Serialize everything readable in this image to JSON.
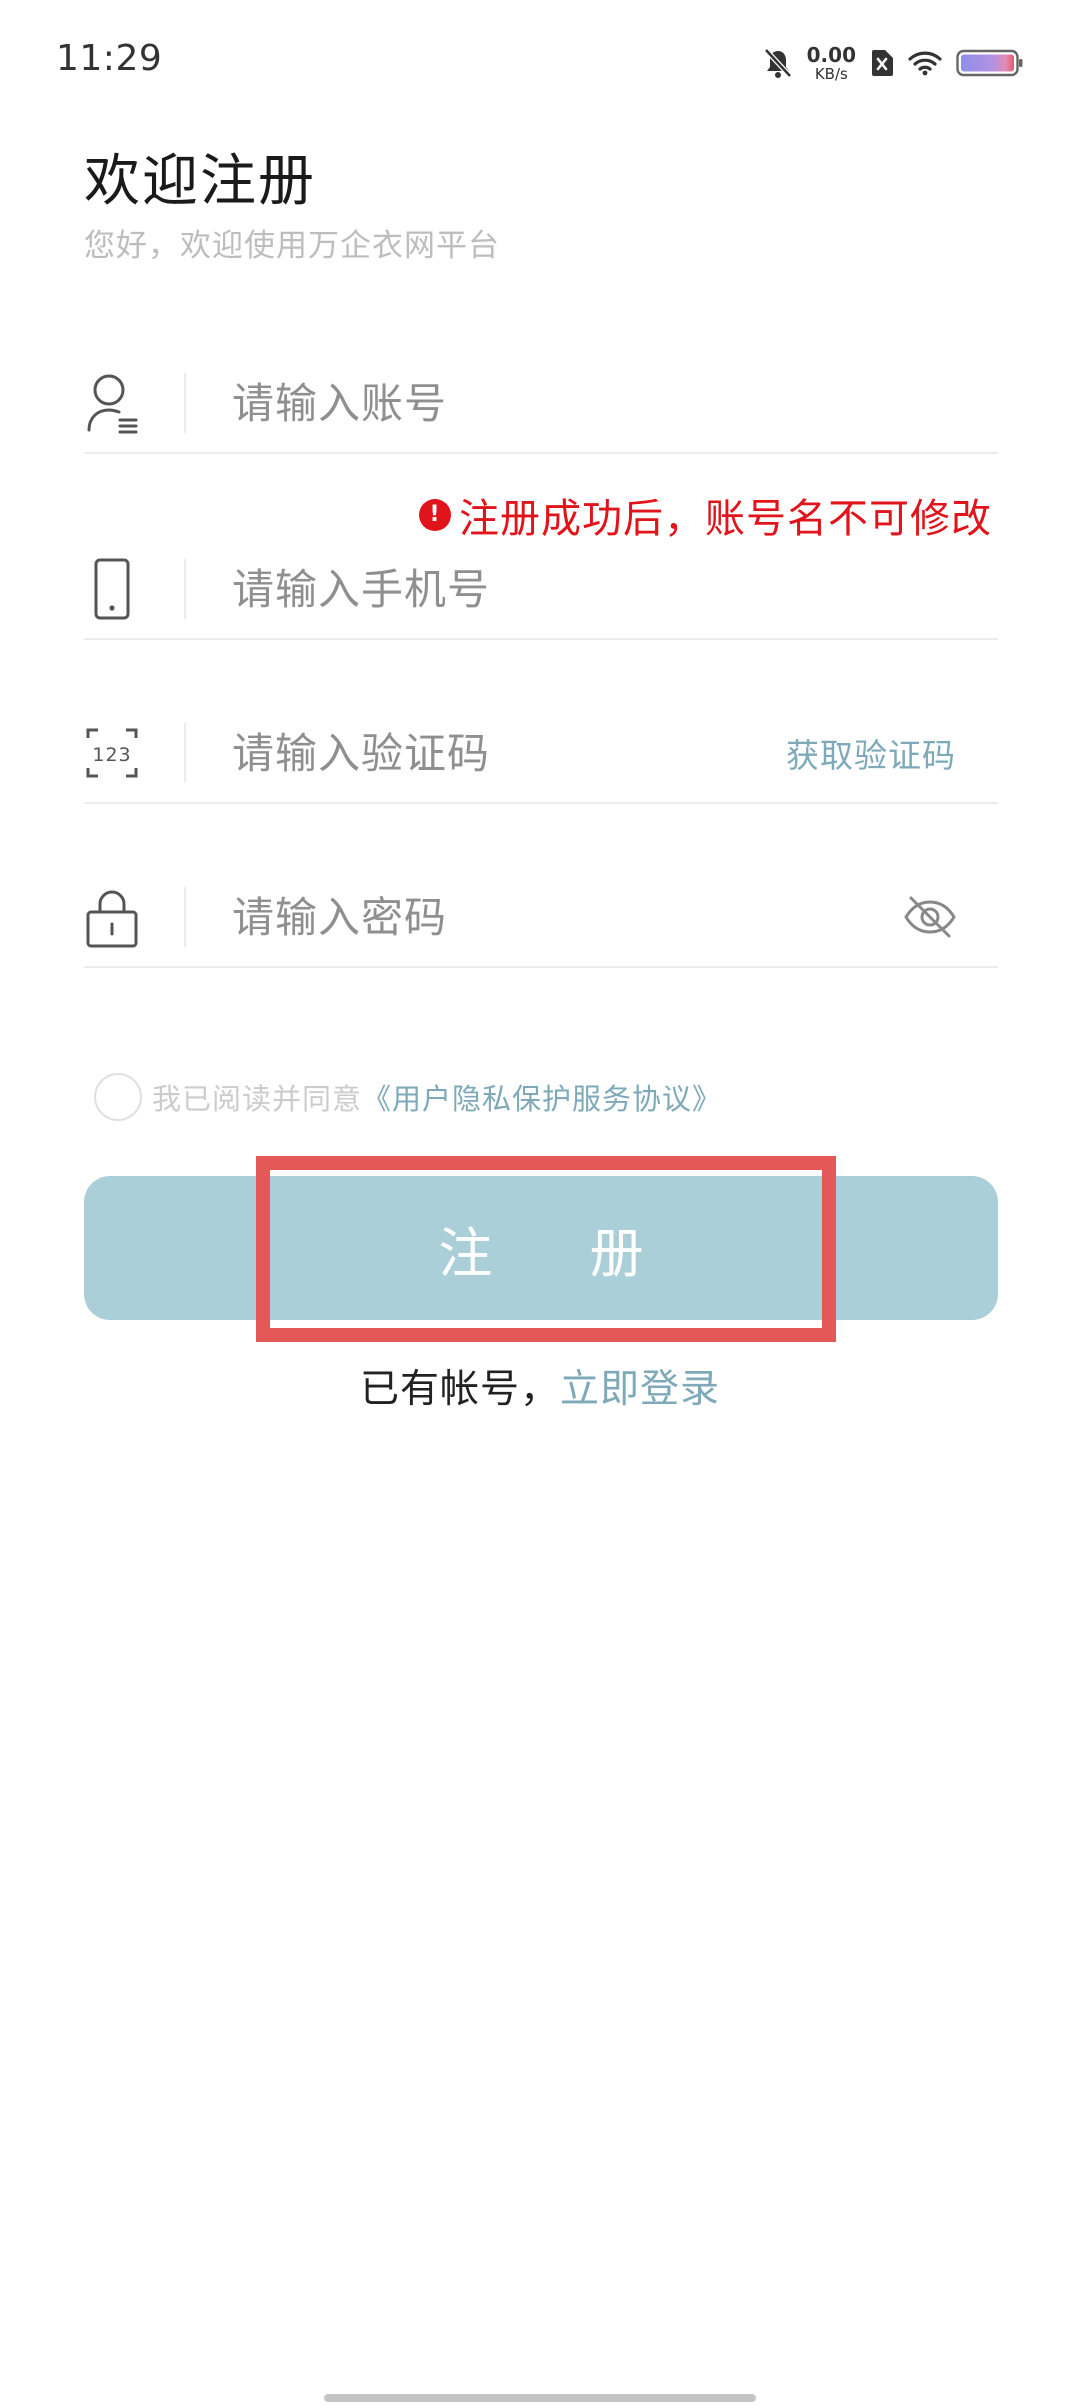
{
  "status_bar": {
    "time": "11:29",
    "net_speed_value": "0.00",
    "net_speed_unit": "KB/s",
    "icons": [
      "bell-muted-icon",
      "sim-x-icon",
      "wifi-icon",
      "battery-icon"
    ]
  },
  "header": {
    "title": "欢迎注册",
    "subtitle": "您好，欢迎使用万企衣网平台"
  },
  "form": {
    "account_placeholder": "请输入账号",
    "account_warning": "注册成功后，账号名不可修改",
    "phone_placeholder": "请输入手机号",
    "code_placeholder": "请输入验证码",
    "get_code_label": "获取验证码",
    "password_placeholder": "请输入密码"
  },
  "agreement": {
    "prefix": "我已阅读并同意",
    "link": "《用户隐私保护服务协议》"
  },
  "register_label": "注 册",
  "login_prompt": {
    "prefix": "已有帐号，",
    "link": "立即登录"
  },
  "colors": {
    "accent": "#7ea9b8",
    "button": "#abcfd8",
    "warning": "#e0141a",
    "highlight_box": "#e55858"
  }
}
